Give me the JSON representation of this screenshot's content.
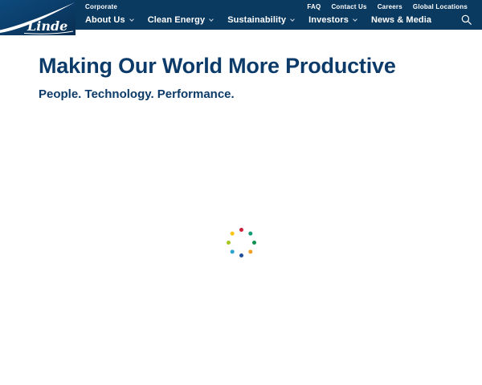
{
  "header": {
    "logo_text": "Linde",
    "utility": {
      "site_label": "Corporate",
      "links": [
        {
          "label": "FAQ"
        },
        {
          "label": "Contact Us"
        },
        {
          "label": "Careers"
        },
        {
          "label": "Global Locations"
        }
      ]
    },
    "nav": {
      "items": [
        {
          "label": "About Us",
          "has_dropdown": true
        },
        {
          "label": "Clean Energy",
          "has_dropdown": true
        },
        {
          "label": "Sustainability",
          "has_dropdown": true
        },
        {
          "label": "Investors",
          "has_dropdown": true
        },
        {
          "label": "News & Media",
          "has_dropdown": false
        }
      ],
      "search_icon": "search-icon"
    }
  },
  "hero": {
    "title": "Making Our World More Productive",
    "subtitle": "People. Technology. Performance."
  },
  "spinner": {
    "dot_colors": [
      "#cb2239",
      "#119c73",
      "#0e9150",
      "#f0a028",
      "#1d4f9e",
      "#2fa3cf",
      "#a5c520",
      "#fdc519"
    ],
    "radius_px": 16
  },
  "colors": {
    "header_bg": "#0b3a61",
    "heading_text": "#0c3b69",
    "logo_gradient_start": "#0d4a7e",
    "logo_gradient_end": "#092f52"
  }
}
